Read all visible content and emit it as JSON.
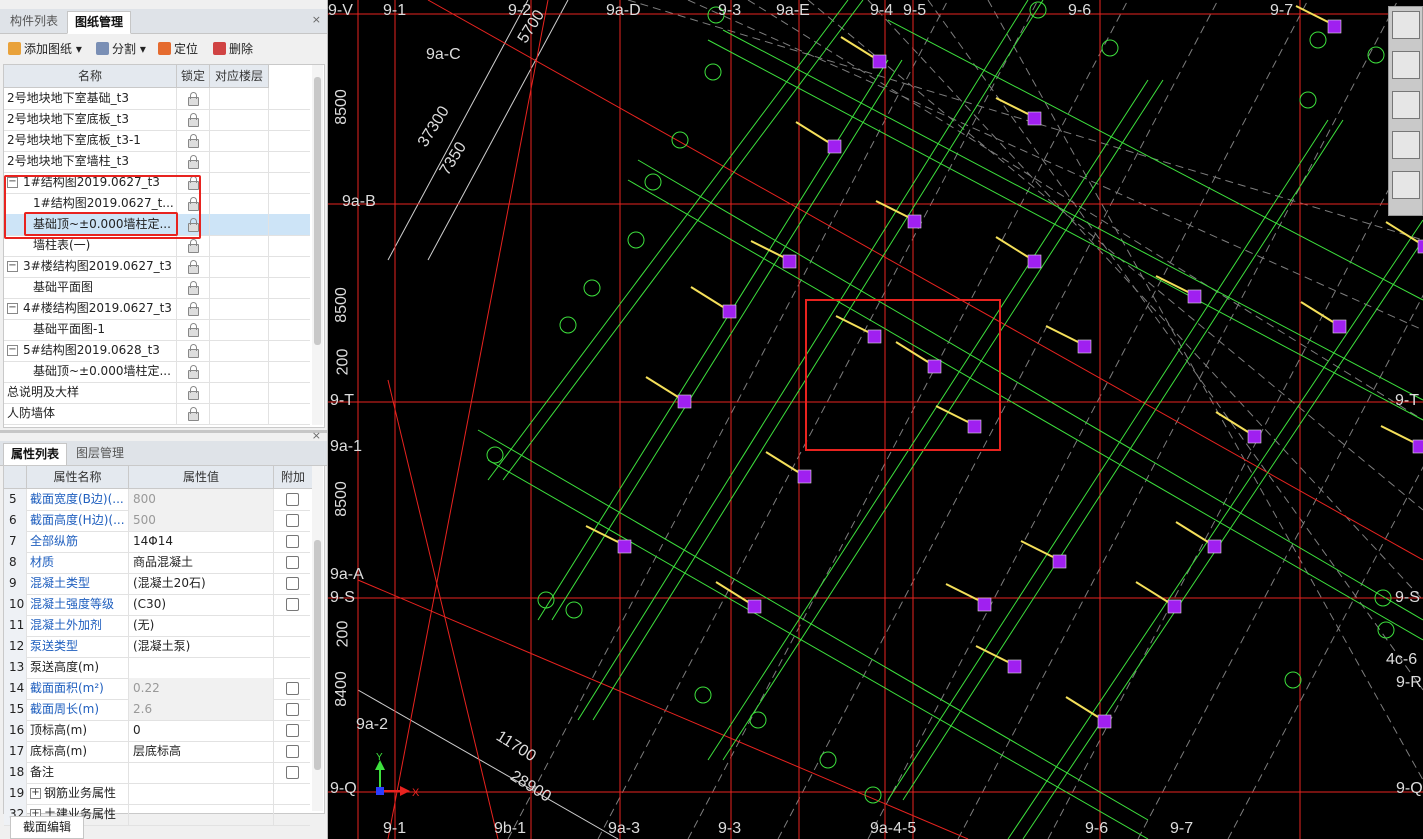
{
  "top_panel": {
    "tabs": [
      {
        "label": "构件列表",
        "active": false
      },
      {
        "label": "图纸管理",
        "active": true
      }
    ],
    "close": "×",
    "toolbar": [
      {
        "label": "添加图纸",
        "icon": "add-drawing-icon",
        "dropdown": "▾"
      },
      {
        "label": "分割",
        "icon": "split-icon",
        "dropdown": "▾"
      },
      {
        "label": "定位",
        "icon": "locate-icon"
      },
      {
        "label": "删除",
        "icon": "delete-icon"
      }
    ],
    "headers": [
      "名称",
      "锁定",
      "对应楼层"
    ],
    "rows": [
      {
        "name": "2号地块地下室基础_t3",
        "indent": 0,
        "expander": ""
      },
      {
        "name": "2号地块地下室底板_t3",
        "indent": 0,
        "expander": ""
      },
      {
        "name": "2号地块地下室底板_t3-1",
        "indent": 0,
        "expander": ""
      },
      {
        "name": "2号地块地下室墙柱_t3",
        "indent": 0,
        "expander": ""
      },
      {
        "name": "1#结构图2019.0627_t3",
        "indent": 1,
        "expander": "−"
      },
      {
        "name": "1#结构图2019.0627_t...",
        "indent": 2,
        "expander": ""
      },
      {
        "name": "基础顶~±0.000墙柱定...",
        "indent": 2,
        "expander": "",
        "selected": true
      },
      {
        "name": "墙柱表(一)",
        "indent": 2,
        "expander": ""
      },
      {
        "name": "3#楼结构图2019.0627_t3",
        "indent": 1,
        "expander": "−"
      },
      {
        "name": "基础平面图",
        "indent": 2,
        "expander": ""
      },
      {
        "name": "4#楼结构图2019.0627_t3",
        "indent": 1,
        "expander": "−"
      },
      {
        "name": "基础平面图-1",
        "indent": 2,
        "expander": ""
      },
      {
        "name": "5#结构图2019.0628_t3",
        "indent": 1,
        "expander": "−"
      },
      {
        "name": "基础顶~±0.000墙柱定...",
        "indent": 2,
        "expander": ""
      },
      {
        "name": "总说明及大样",
        "indent": 0,
        "expander": ""
      },
      {
        "name": "人防墙体",
        "indent": 0,
        "expander": ""
      }
    ]
  },
  "bottom_panel": {
    "tabs": [
      {
        "label": "属性列表",
        "active": true
      },
      {
        "label": "图层管理",
        "active": false
      }
    ],
    "close": "×",
    "headers": [
      "",
      "属性名称",
      "属性值",
      "附加"
    ],
    "rows": [
      {
        "num": "5",
        "name": "截面宽度(B边)(...",
        "value": "800",
        "blue": true,
        "grey": true,
        "check": true
      },
      {
        "num": "6",
        "name": "截面高度(H边)(...",
        "value": "500",
        "blue": true,
        "grey": true,
        "check": true
      },
      {
        "num": "7",
        "name": "全部纵筋",
        "value": "14Φ14",
        "blue": true,
        "grey": false,
        "check": true
      },
      {
        "num": "8",
        "name": "材质",
        "value": "商品混凝土",
        "blue": true,
        "grey": false,
        "check": true
      },
      {
        "num": "9",
        "name": "混凝土类型",
        "value": "(混凝土20石)",
        "blue": true,
        "grey": false,
        "check": true
      },
      {
        "num": "10",
        "name": "混凝土强度等级",
        "value": "(C30)",
        "blue": true,
        "grey": false,
        "check": true
      },
      {
        "num": "11",
        "name": "混凝土外加剂",
        "value": "(无)",
        "blue": true,
        "grey": false,
        "check": false
      },
      {
        "num": "12",
        "name": "泵送类型",
        "value": "(混凝土泵)",
        "blue": true,
        "grey": false,
        "check": false
      },
      {
        "num": "13",
        "name": "泵送高度(m)",
        "value": "",
        "blue": false,
        "grey": false,
        "check": false
      },
      {
        "num": "14",
        "name": "截面面积(m²)",
        "value": "0.22",
        "blue": true,
        "grey": true,
        "check": true
      },
      {
        "num": "15",
        "name": "截面周长(m)",
        "value": "2.6",
        "blue": true,
        "grey": true,
        "check": true
      },
      {
        "num": "16",
        "name": "顶标高(m)",
        "value": "0",
        "blue": false,
        "grey": false,
        "check": true
      },
      {
        "num": "17",
        "name": "底标高(m)",
        "value": "层底标高",
        "blue": false,
        "grey": false,
        "check": true
      },
      {
        "num": "18",
        "name": "备注",
        "value": "",
        "blue": false,
        "grey": false,
        "check": true
      },
      {
        "num": "19",
        "name": "钢筋业务属性",
        "value": "",
        "blue": false,
        "grey": false,
        "check": false,
        "expander": "+"
      },
      {
        "num": "32",
        "name": "土建业务属性",
        "value": "",
        "blue": false,
        "grey": false,
        "check": false,
        "expander": "+"
      }
    ],
    "section_edit_button": "截面编辑"
  },
  "cad": {
    "top_labels": [
      "9-V",
      "9-1",
      "9-2",
      "9a-D",
      "9-3",
      "9a-E",
      "9-4",
      "9-5",
      "9-6",
      "9-7"
    ],
    "bottom_labels": [
      "9-1",
      "9b-1",
      "9a-3",
      "9-3",
      "9a-4-5",
      "9-6",
      "9-7"
    ],
    "left_labels": [
      "9a-C",
      "9a-B",
      "9-T",
      "9a-1",
      "9a-A",
      "9-S",
      "9a-2",
      "9-Q"
    ],
    "right_labels": [
      "9-T",
      "9-S",
      "4c-6",
      "9-R",
      "9-Q"
    ],
    "dims": [
      "5700",
      "37300",
      "7350",
      "8500",
      "8500",
      "200",
      "8500",
      "200",
      "8400",
      "11700",
      "28900"
    ],
    "ucs": {
      "x": "X",
      "y": "Y"
    },
    "tools": [
      "view-3d-icon",
      "box-icon",
      "cube-icon",
      "rotate-icon",
      "layers-icon"
    ],
    "colors": {
      "background": "#000000",
      "grid": "#e8231f",
      "beam": "#3de03d",
      "column": "#a020f0",
      "wall": "#f5e05a",
      "highlight": "#e8231f"
    }
  }
}
